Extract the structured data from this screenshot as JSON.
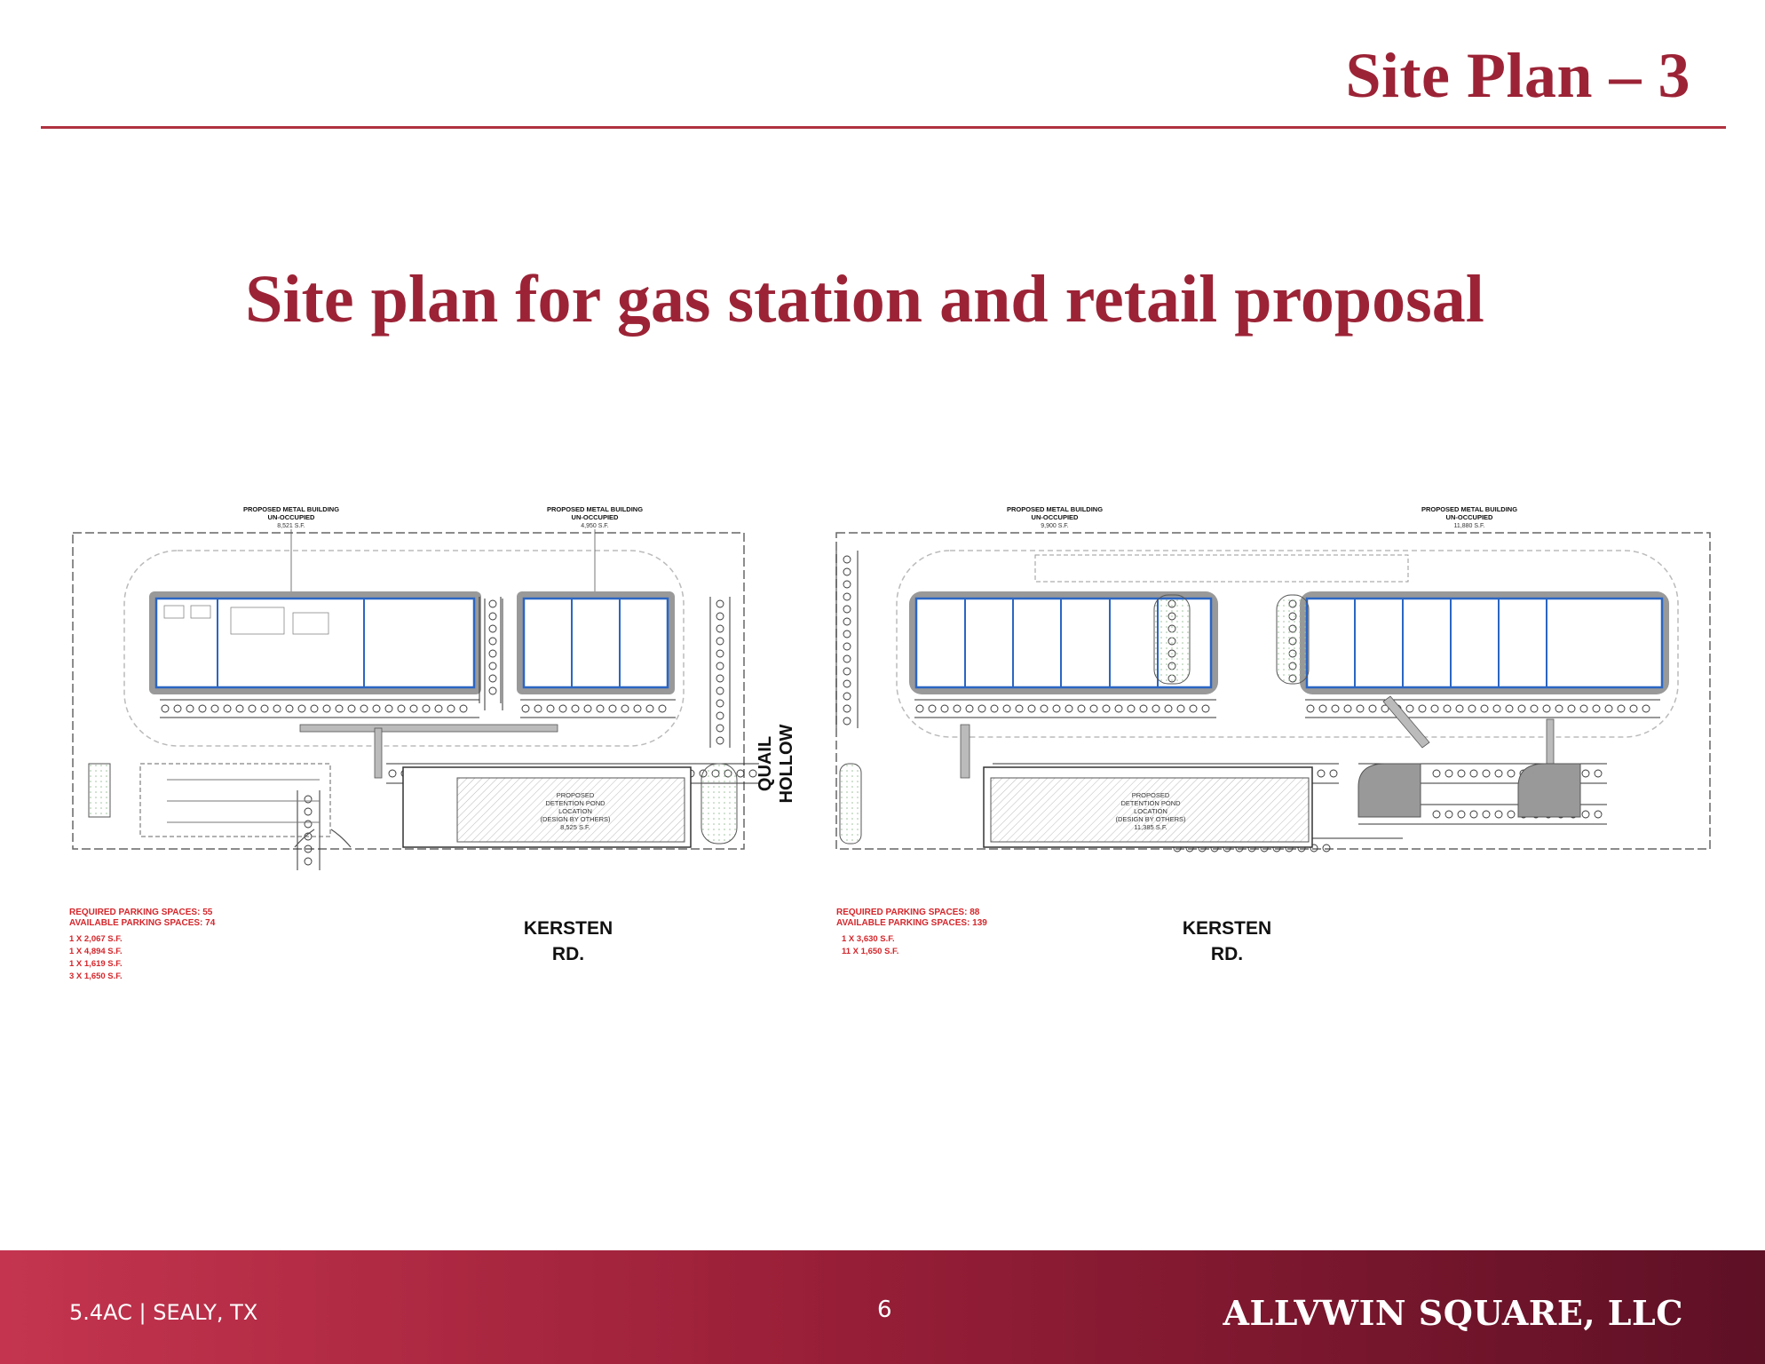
{
  "header": {
    "title": "Site Plan – 3"
  },
  "subtitle": "Site plan for gas station and retail proposal",
  "plans": [
    {
      "building_labels": [
        {
          "title": "PROPOSED METAL BUILDING",
          "status": "UN-OCCUPIED",
          "area": "8,521 S.F."
        },
        {
          "title": "PROPOSED METAL BUILDING",
          "status": "UN-OCCUPIED",
          "area": "4,950 S.F."
        }
      ],
      "pond": {
        "line1": "PROPOSED",
        "line2": "DETENTION POND",
        "line3": "LOCATION",
        "line4": "(DESIGN BY OTHERS)",
        "area": "8,525 S.F."
      },
      "required_parking": "REQUIRED PARKING SPACES: 55",
      "available_parking": "AVAILABLE PARKING SPACES: 74",
      "units": [
        "1 X 2,067 S.F.",
        "1 X 4,894 S.F.",
        "1 X 1,619 S.F.",
        "3 X 1,650 S.F."
      ],
      "road_line1": "KERSTEN",
      "road_line2": "RD."
    },
    {
      "building_labels": [
        {
          "title": "PROPOSED METAL BUILDING",
          "status": "UN-OCCUPIED",
          "area": "9,900 S.F."
        },
        {
          "title": "PROPOSED METAL BUILDING",
          "status": "UN-OCCUPIED",
          "area": "11,880 S.F."
        }
      ],
      "pond": {
        "line1": "PROPOSED",
        "line2": "DETENTION POND",
        "line3": "LOCATION",
        "line4": "(DESIGN BY OTHERS)",
        "area": "11,385 S.F."
      },
      "required_parking": "REQUIRED PARKING SPACES: 88",
      "available_parking": "AVAILABLE PARKING SPACES: 139",
      "units": [
        "1 X 3,630 S.F.",
        "11 X 1,650 S.F."
      ],
      "road_line1": "KERSTEN",
      "road_line2": "RD."
    }
  ],
  "quail_hollow": {
    "line1": "QUAIL",
    "line2": "HOLLOW"
  },
  "footer": {
    "left": "5.4AC | SEALY, TX",
    "page": "6",
    "right": "ALLVWIN SQUARE, LLC"
  }
}
